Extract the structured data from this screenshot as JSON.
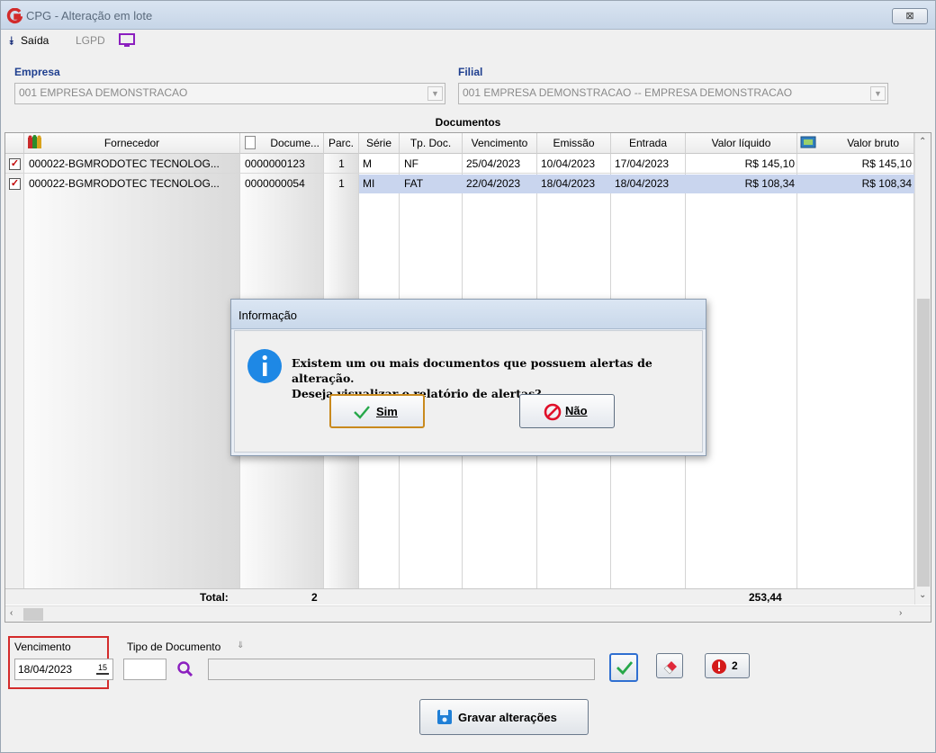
{
  "window": {
    "title": "CPG - Alteração em lote",
    "close_glyph": "⊠"
  },
  "toolbar": {
    "saida": "Saída",
    "lgpd": "LGPD"
  },
  "empresa": {
    "label": "Empresa",
    "value": "001 EMPRESA DEMONSTRACAO"
  },
  "filial": {
    "label": "Filial",
    "value": "001 EMPRESA DEMONSTRACAO -- EMPRESA DEMONSTRACAO"
  },
  "documents": {
    "title": "Documentos",
    "columns": [
      "Fornecedor",
      "Docume...",
      "Parc.",
      "Série",
      "Tp. Doc.",
      "Vencimento",
      "Emissão",
      "Entrada",
      "Valor líquido",
      "Valor bruto"
    ],
    "rows": [
      {
        "checked": true,
        "fornecedor": "000022-BGMRODOTEC TECNOLOG...",
        "documento": "0000000123",
        "parc": "1",
        "serie": "M",
        "tp_doc": "NF",
        "vencimento": "25/04/2023",
        "emissao": "10/04/2023",
        "entrada": "17/04/2023",
        "valor_liquido": "R$ 145,10",
        "valor_bruto": "R$ 145,10"
      },
      {
        "checked": true,
        "fornecedor": "000022-BGMRODOTEC TECNOLOG...",
        "documento": "0000000054",
        "parc": "1",
        "serie": "MI",
        "tp_doc": "FAT",
        "vencimento": "22/04/2023",
        "emissao": "18/04/2023",
        "entrada": "18/04/2023",
        "valor_liquido": "R$ 108,34",
        "valor_bruto": "R$ 108,34"
      }
    ],
    "total_label": "Total:",
    "total_count": "2",
    "total_value": "253,44"
  },
  "bottom": {
    "vencimento_label": "Vencimento",
    "vencimento_value": "18/04/2023",
    "tipo_doc_label": "Tipo de Documento",
    "alert_count": "2",
    "save_label": "Gravar alterações"
  },
  "dialog": {
    "title": "Informação",
    "line1": "Existem um ou mais documentos que possuem alertas de alteração.",
    "line2": "Deseja visualizar o relatório de alertas?",
    "yes": "Sim",
    "no": "Não"
  },
  "colors": {
    "selected_row": "#c9d5ee",
    "accent_red": "#d42b2b",
    "label_blue": "#1f3f8f"
  }
}
